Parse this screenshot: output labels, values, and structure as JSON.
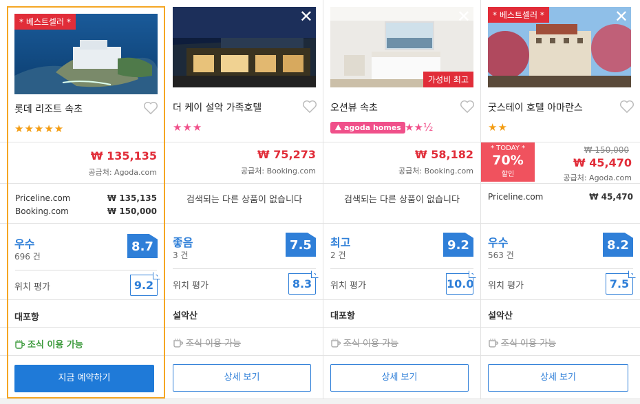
{
  "hotels": [
    {
      "badge": "* 베스트셀러 *",
      "name": "롯데 리조트 속초",
      "stars": "★★★★★",
      "price": "₩ 135,135",
      "supplier": "공급처: Agoda.com",
      "alts": [
        {
          "site": "Priceline.com",
          "price": "₩ 135,135"
        },
        {
          "site": "Booking.com",
          "price": "₩ 150,000"
        }
      ],
      "rating_word": "우수",
      "rating_count": "696 건",
      "score": "8.7",
      "loc_label": "위치 평가",
      "loc_score": "9.2",
      "area": "대포항",
      "breakfast": "조식 이용 가능",
      "button": "지금 예약하기"
    },
    {
      "close": "✕",
      "name": "더 케이 설악 가족호텔",
      "stars": "★★★",
      "price": "₩ 75,273",
      "supplier": "공급처: Booking.com",
      "none_msg": "검색되는 다른 상품이 없습니다",
      "rating_word": "좋음",
      "rating_count": "3 건",
      "score": "7.5",
      "loc_label": "위치 평가",
      "loc_score": "8.3",
      "area": "설악산",
      "breakfast": "조식 이용 가능",
      "button": "상세 보기"
    },
    {
      "close": "✕",
      "badge2": "가성비 최고",
      "name": "오션뷰 속초",
      "agoda": "agoda homes",
      "stars": "★★½",
      "price": "₩ 58,182",
      "supplier": "공급처: Booking.com",
      "none_msg": "검색되는 다른 상품이 없습니다",
      "rating_word": "최고",
      "rating_count": "2 건",
      "score": "9.2",
      "loc_label": "위치 평가",
      "loc_score": "10.0",
      "area": "대포항",
      "breakfast": "조식 이용 가능",
      "button": "상세 보기"
    },
    {
      "badge": "* 베스트셀러 *",
      "close": "✕",
      "name": "굿스테이 호텔 아마란스",
      "stars": "★★",
      "today": {
        "label": "* TODAY *",
        "pct": "70%",
        "sub": "할인"
      },
      "old_price": "₩ 150,000",
      "price": "₩ 45,470",
      "supplier": "공급처: Agoda.com",
      "alts": [
        {
          "site": "Priceline.com",
          "price": "₩ 45,470"
        }
      ],
      "rating_word": "우수",
      "rating_count": "563 건",
      "score": "8.2",
      "loc_label": "위치 평가",
      "loc_score": "7.5",
      "area": "설악산",
      "breakfast": "조식 이용 가능",
      "button": "상세 보기"
    }
  ]
}
